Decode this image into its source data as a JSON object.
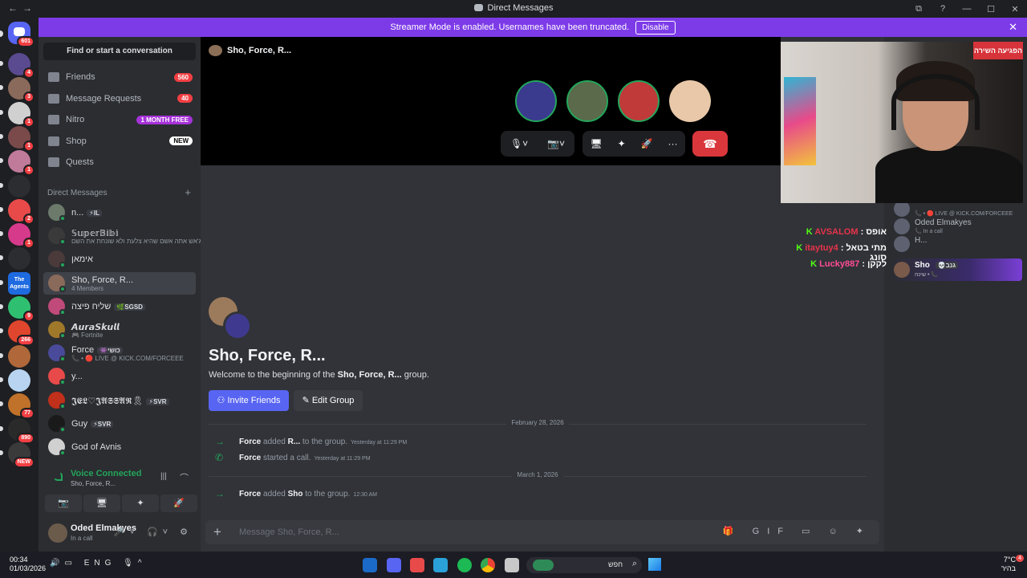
{
  "window": {
    "title": "Direct Messages",
    "back": "←",
    "forward": "→",
    "controls": [
      "⧉",
      "?",
      "—",
      "☐",
      "✕"
    ]
  },
  "banner": {
    "text": "Streamer Mode is enabled. Usernames have been truncated.",
    "button": "Disable",
    "close": "✕"
  },
  "guilds": {
    "home_badge": "601",
    "items": [
      {
        "badge": "4",
        "color": "#5a4a8f"
      },
      {
        "badge": "3",
        "color": "#8a6a5a"
      },
      {
        "badge": "1",
        "color": "#d0d0d0"
      },
      {
        "badge": "1",
        "color": "#7a4a4a"
      },
      {
        "badge": "1",
        "color": "#c07a9a"
      },
      {
        "badge": "",
        "color": "#2b2d31"
      },
      {
        "badge": "2",
        "color": "#e84a4a"
      },
      {
        "badge": "1",
        "color": "#d63a8a"
      },
      {
        "badge": "",
        "color": "#2b2d31"
      },
      {
        "badge": "",
        "color": "#1e6ae0",
        "label": "The Agents"
      },
      {
        "badge": "9",
        "color": "#2fbf71"
      },
      {
        "badge": "266",
        "color": "#e0452e"
      },
      {
        "badge": "",
        "color": "#b0683a"
      },
      {
        "badge": "",
        "color": "#b8d4f0"
      },
      {
        "badge": "77",
        "color": "#c0712a"
      },
      {
        "badge": "890",
        "color": "#2a2a2a"
      },
      {
        "badge": "NEW",
        "color": "#3a3a3a"
      }
    ]
  },
  "sidebar": {
    "search": "Find or start a conversation",
    "nav": [
      {
        "label": "Friends",
        "pill": "560",
        "pill_color": "#f23f43"
      },
      {
        "label": "Message Requests",
        "pill": "40",
        "pill_color": "#f23f43"
      },
      {
        "label": "Nitro",
        "pill": "1 MONTH FREE",
        "pill_color": "#a632d9"
      },
      {
        "label": "Shop",
        "pill": "NEW",
        "pill_color": "#ffffff"
      },
      {
        "label": "Quests",
        "pill": "",
        "pill_color": ""
      }
    ],
    "dm_header": "Direct Messages",
    "dm_add": "+",
    "dms": [
      {
        "name": "n...",
        "tag": "⚡IL",
        "sub": "",
        "color": "#6b7a6b"
      },
      {
        "name": "𝕊𝕦𝕡𝕖𝕣𝔹𝕚𝕓𝕚",
        "tag": "",
        "sub": "ג'אש אתה אשם שהיא צלעת ולא שונחת את השם",
        "color": "#3a3a3a"
      },
      {
        "name": "אימאן",
        "tag": "",
        "sub": "",
        "color": "#4a3a3a"
      },
      {
        "name": "Sho, Force, R...",
        "tag": "",
        "sub": "4 Members",
        "color": "#8a6a5a"
      },
      {
        "name": "שליח פיצה",
        "tag": "🌿SGSD",
        "sub": "",
        "color": "#c04a7a"
      },
      {
        "name": "𝘼𝙪𝙧𝙖𝙎𝙠𝙪𝙡𝙡",
        "tag": "",
        "sub": "🎮 Fortnite",
        "color": "#a0782a"
      },
      {
        "name": "Force",
        "tag": "👾כושי",
        "sub": "📞 • 🔴 LIVE @ KICK.COM/FORCEEE",
        "color": "#4a4a9a"
      },
      {
        "name": "y...",
        "tag": "",
        "sub": "",
        "color": "#e84a4a"
      },
      {
        "name": "𝕵𝕰𝕷♡𝕵𝕬𝕾𝕾𝕬𝕽🎗",
        "tag": "⚡SVR",
        "sub": "",
        "color": "#c0301a"
      },
      {
        "name": "Guy",
        "tag": "⚡SVR",
        "sub": "",
        "color": "#1a1a1a"
      },
      {
        "name": "God of Avnis",
        "tag": "",
        "sub": "",
        "color": "#d0d0d0"
      }
    ],
    "voice": {
      "status": "Voice Connected",
      "channel": "Sho, Force, R...",
      "buttons": [
        "📷",
        "🖥",
        "✦",
        "🚀"
      ]
    },
    "user": {
      "name": "Oded Elmakyes",
      "status": "In a call",
      "controls": "🎤˅ 🎧˅ ⚙"
    }
  },
  "call": {
    "header": "Sho, Force, R...",
    "participants": [
      {
        "name": "participant-1",
        "color": "#3a3a8f"
      },
      {
        "name": "participant-2",
        "color": "#5a6a4a"
      },
      {
        "name": "participant-3",
        "color": "#c03a3a"
      },
      {
        "name": "participant-4",
        "color": "#e8c8a8"
      }
    ],
    "controls": {
      "mic": "🎙˅",
      "camera": "📷˅",
      "share": "🖥",
      "activities": "✦",
      "soundboard": "🚀",
      "more": "···",
      "hangup": "☎"
    }
  },
  "webcam": {
    "sign_text": "הפגיעה השירה"
  },
  "kick_chat": [
    {
      "user": "AVSALOM",
      "msg": "אופס",
      "color": "#e8334a"
    },
    {
      "user": "itaytuy4",
      "msg": "מתי בטאל סונג",
      "color": "#e8334a"
    },
    {
      "user": "Lucky887",
      "msg": "לקקן",
      "color": "#ff4d94"
    }
  ],
  "right_panel": {
    "rows": [
      {
        "name": "",
        "sub": "📞 • 🔴 LIVE @ KICK.COM/FORCEEE"
      },
      {
        "name": "Oded Elmakyes",
        "sub": "📞 In a call"
      },
      {
        "name": "H...",
        "sub": ""
      }
    ],
    "highlight": {
      "name": "Sho",
      "tag": "💀גנב",
      "sub": "שינה • 📞"
    }
  },
  "welcome": {
    "title": "Sho, Force, R...",
    "pre": "Welcome to the beginning of the ",
    "group": "Sho, Force, R...",
    "post": " group.",
    "invite": "Invite Friends",
    "edit": "Edit Group"
  },
  "messages": [
    {
      "date": "February 28, 2026"
    },
    {
      "actor": "Force",
      "verb": " added ",
      "target": "R...",
      "rest": " to the group.",
      "ts": "Yesterday at 11:29 PM",
      "icon": "→"
    },
    {
      "actor": "Force",
      "verb": " started a call.",
      "target": "",
      "rest": "",
      "ts": "Yesterday at 11:29 PM",
      "icon": "✆"
    },
    {
      "date": "March 1, 2026"
    },
    {
      "actor": "Force",
      "verb": " added ",
      "target": "Sho",
      "rest": " to the group.",
      "ts": "12:30 AM",
      "icon": "→"
    }
  ],
  "composer": {
    "plus": "+",
    "placeholder": "Message Sho, Force, R...",
    "tools": "🎁 GIF ▭ ☺ ✦"
  },
  "taskbar": {
    "time": "00:34",
    "date": "01/03/2026",
    "lang": "ENG",
    "search": "חפש",
    "weather": "7°C",
    "weather_sub": "בהיר",
    "notif": "4"
  }
}
